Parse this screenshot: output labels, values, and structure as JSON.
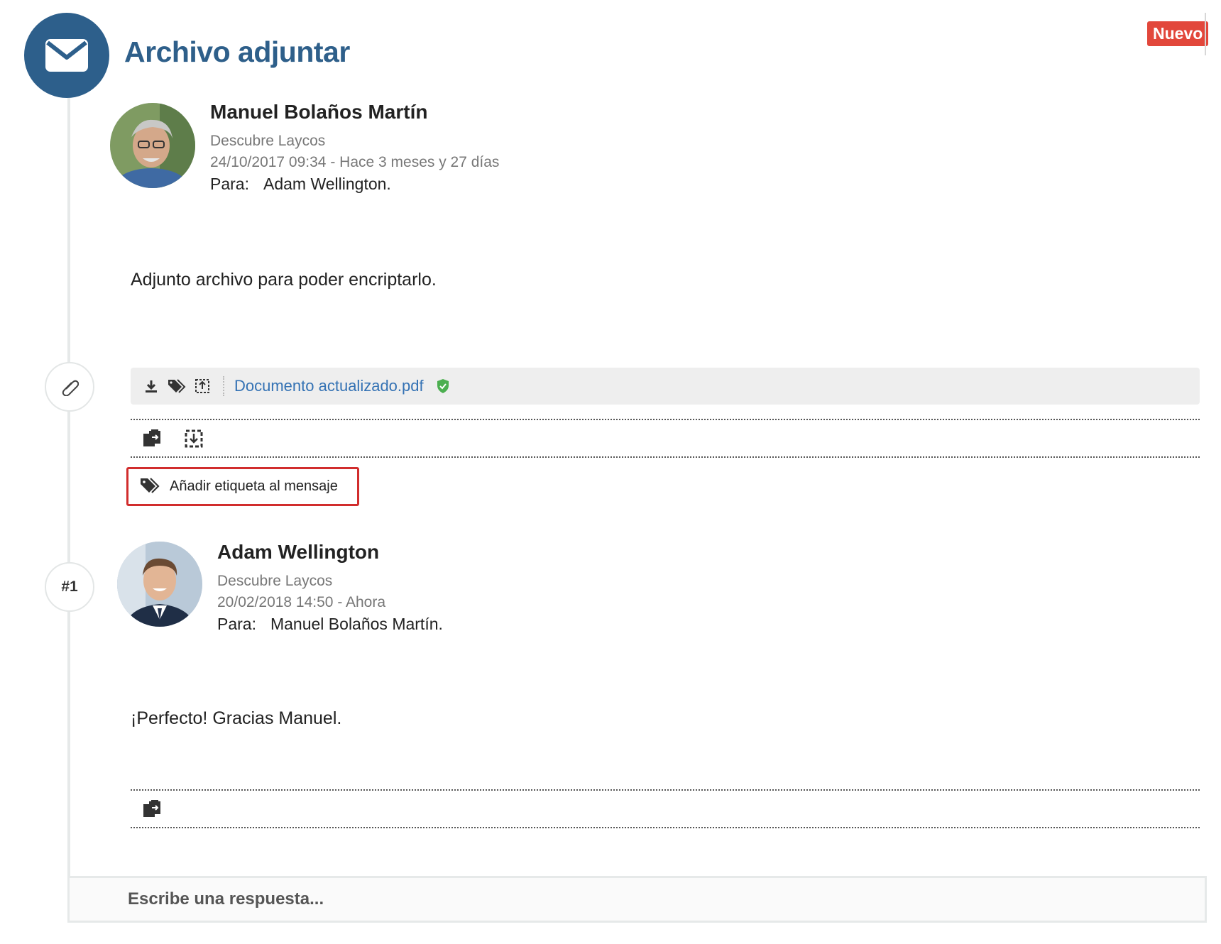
{
  "header": {
    "title": "Archivo adjuntar",
    "badge": "Nuevo",
    "icon": "envelope-icon"
  },
  "messages": [
    {
      "author": "Manuel Bolaños Martín",
      "company": "Descubre Laycos",
      "date": "24/10/2017 09:34 - Hace 3 meses y 27 días",
      "to_label": "Para:",
      "to": "Adam Wellington.",
      "body": "Adjunto archivo para poder encriptarlo.",
      "attachment": {
        "filename": "Documento actualizado.pdf",
        "icons": [
          "download-icon",
          "tags-icon",
          "upload-box-icon",
          "shield-check-icon"
        ]
      },
      "tag_button": "Añadir etiqueta al mensaje"
    },
    {
      "author": "Adam Wellington",
      "company": "Descubre Laycos",
      "date": "20/02/2018 14:50 - Ahora",
      "to_label": "Para:",
      "to": "Manuel Bolaños Martín.",
      "body": "¡Perfecto! Gracias Manuel.",
      "marker": "#1"
    }
  ],
  "reply": {
    "placeholder": "Escribe una respuesta..."
  },
  "colors": {
    "brand": "#2d5f8b",
    "badge": "#e2473b",
    "link": "#3472b4",
    "highlight": "#d12d2d",
    "shield": "#4caf50"
  }
}
